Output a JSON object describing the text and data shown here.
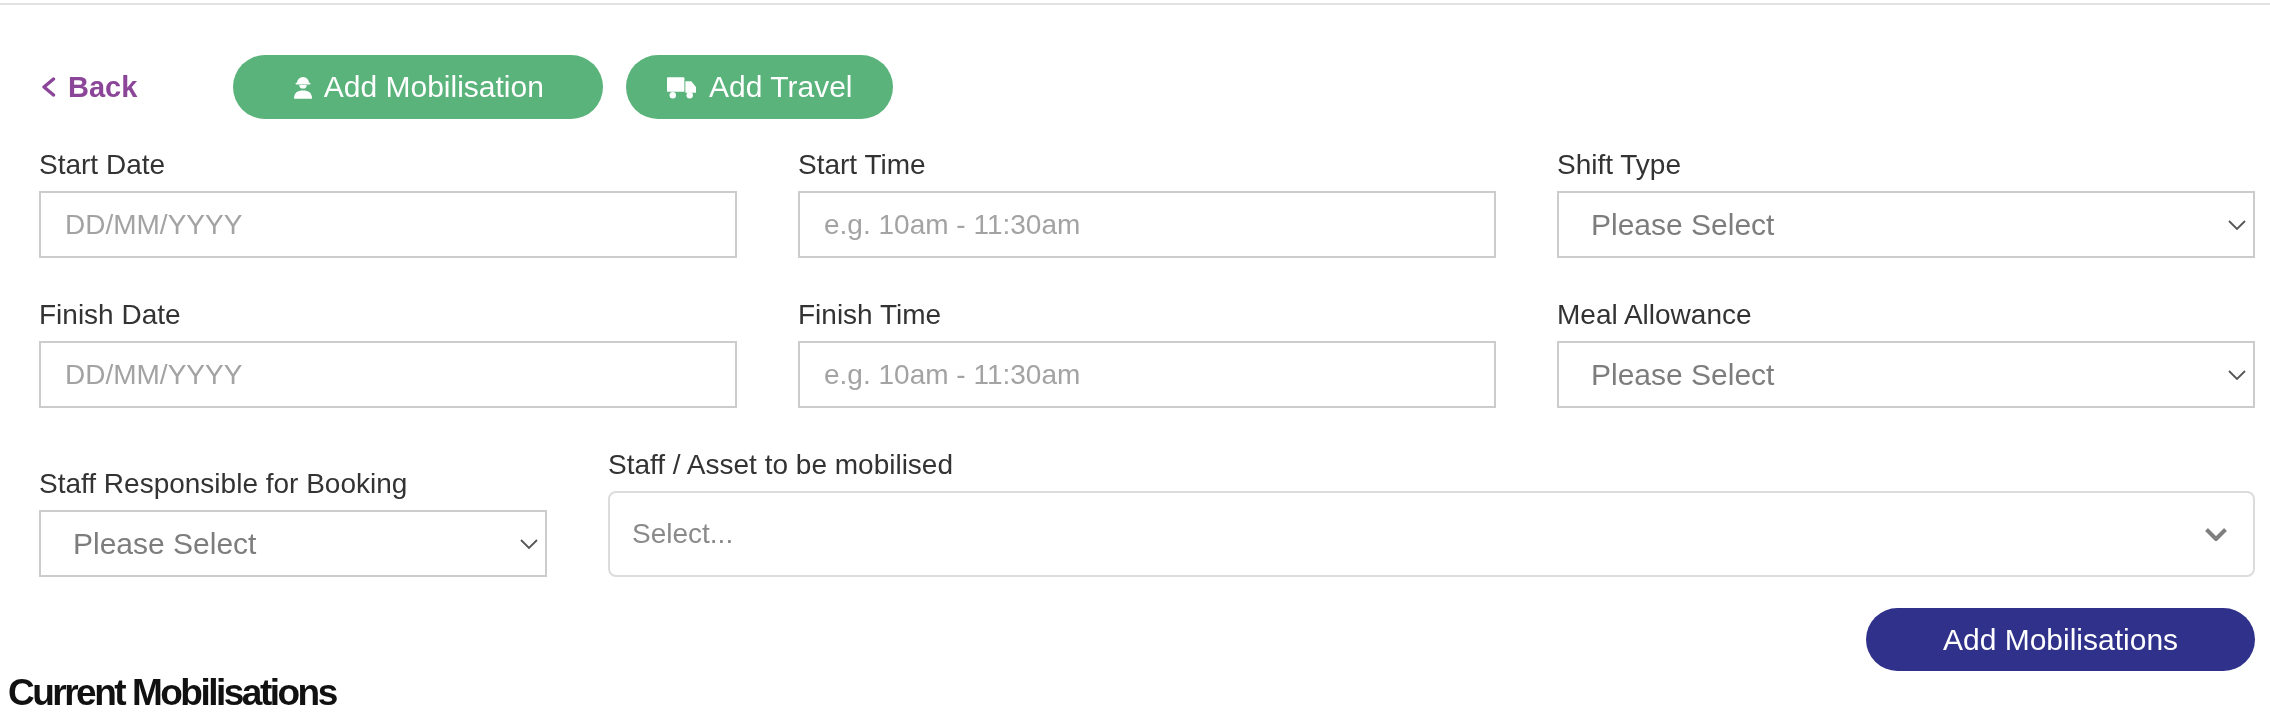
{
  "toolbar": {
    "back_link": "Back",
    "add_mobilisation_button": "Add Mobilisation",
    "add_travel_button": "Add Travel"
  },
  "fields": [
    {
      "label": "Start Date",
      "kind": "text",
      "placeholder": "DD/MM/YYYY"
    },
    {
      "label": "Start Time",
      "kind": "text",
      "placeholder": "e.g. 10am - 11:30am"
    },
    {
      "label": "Shift Type",
      "kind": "select",
      "value": "Please Select"
    },
    {
      "label": "Finish Date",
      "kind": "text",
      "placeholder": "DD/MM/YYYY"
    },
    {
      "label": "Finish Time",
      "kind": "text",
      "placeholder": "e.g. 10am - 11:30am"
    },
    {
      "label": "Meal Allowance",
      "kind": "select",
      "value": "Please Select"
    }
  ],
  "assignment_fields": [
    {
      "label": "Staff Responsible for Booking",
      "kind": "select",
      "value": "Please Select"
    },
    {
      "label": "Staff / Asset to be mobilised",
      "kind": "combobox",
      "placeholder": "Select..."
    }
  ],
  "submit_button": "Add Mobilisations",
  "section_title": "Current Mobilisations"
}
